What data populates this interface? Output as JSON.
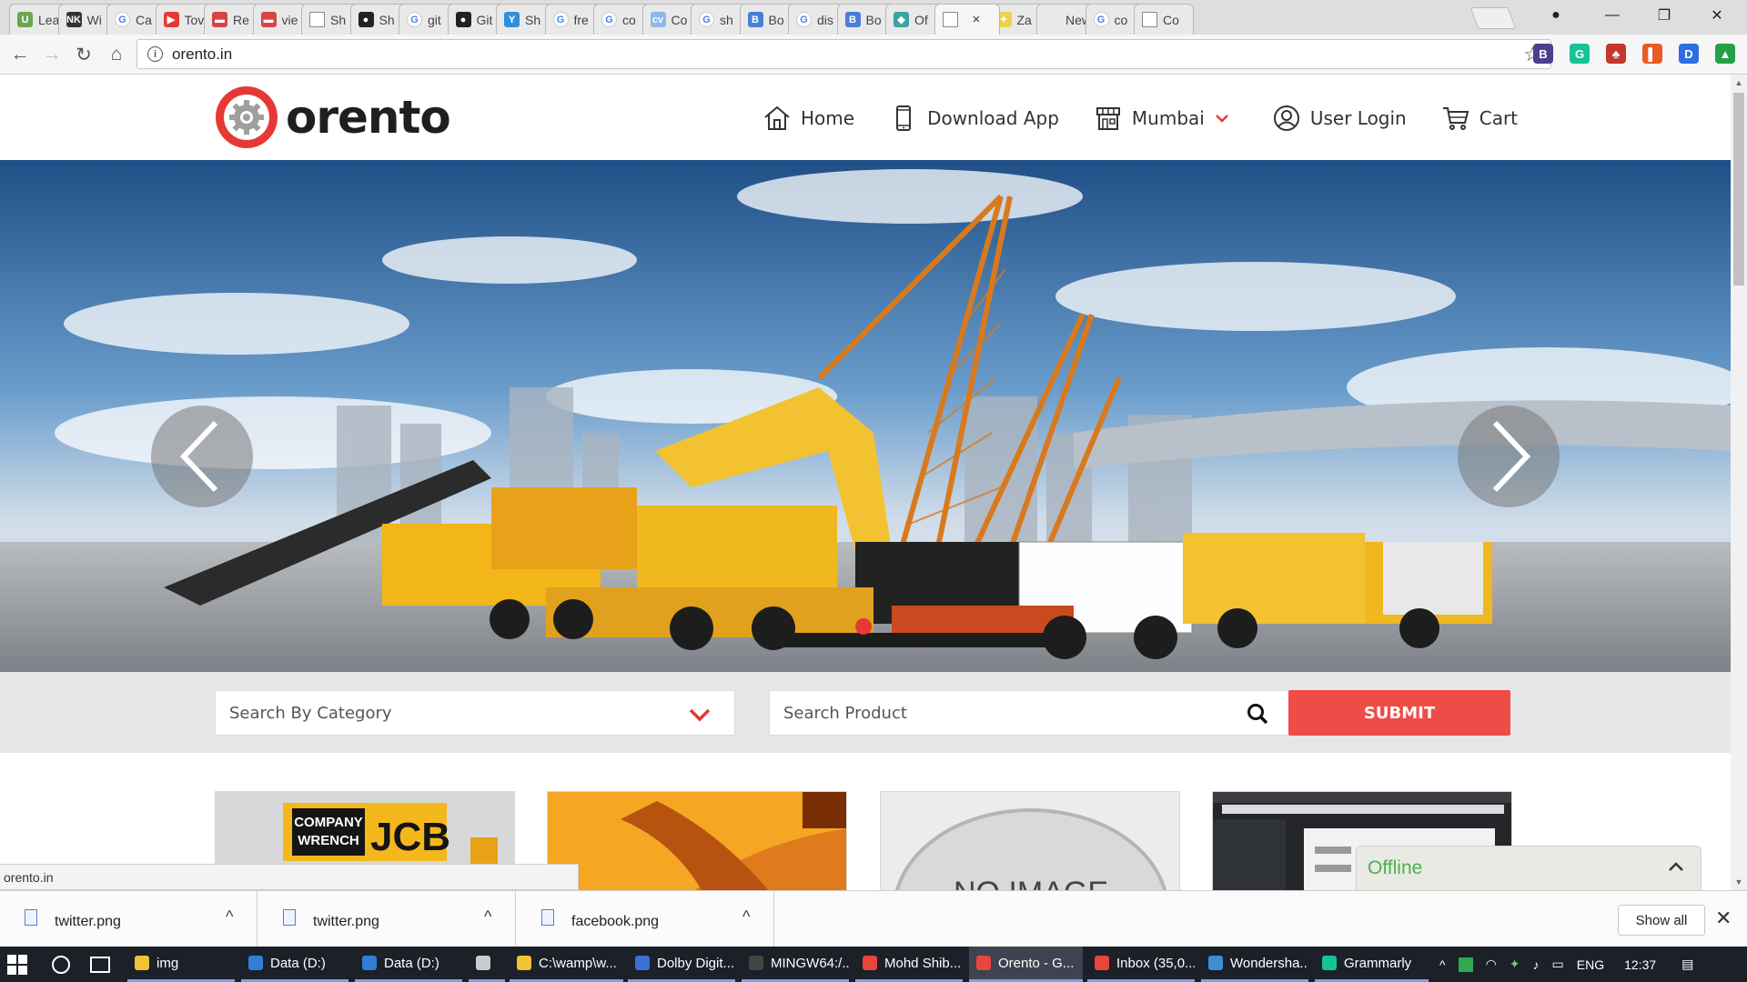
{
  "browser": {
    "tabs": [
      {
        "label": "Lea",
        "icon": "U",
        "color": "#6aa84f"
      },
      {
        "label": "Wi",
        "icon": "NK",
        "color": "#333333"
      },
      {
        "label": "Ca",
        "icon": "G",
        "color": "#ffffff",
        "google": true
      },
      {
        "label": "Tov",
        "icon": "▶",
        "color": "#e53935"
      },
      {
        "label": "Re",
        "icon": "▬",
        "color": "#d64545"
      },
      {
        "label": "vie",
        "icon": "▬",
        "color": "#d64545"
      },
      {
        "label": "Sh",
        "icon": "",
        "color": "#ffffff",
        "doc": true
      },
      {
        "label": "Sh",
        "icon": "●",
        "color": "#222222"
      },
      {
        "label": "git",
        "icon": "G",
        "color": "#ffffff",
        "google": true
      },
      {
        "label": "Git",
        "icon": "●",
        "color": "#222222"
      },
      {
        "label": "Sh",
        "icon": "Y",
        "color": "#2f8fd8"
      },
      {
        "label": "fre",
        "icon": "G",
        "color": "#ffffff",
        "google": true
      },
      {
        "label": "co",
        "icon": "G",
        "color": "#ffffff",
        "google": true
      },
      {
        "label": "Co",
        "icon": "cv",
        "color": "#8fb7e8"
      },
      {
        "label": "sh",
        "icon": "G",
        "color": "#ffffff",
        "google": true
      },
      {
        "label": "Bo",
        "icon": "B",
        "color": "#4a7fd4"
      },
      {
        "label": "dis",
        "icon": "G",
        "color": "#ffffff",
        "google": true
      },
      {
        "label": "Bo",
        "icon": "B",
        "color": "#4a7fd4"
      },
      {
        "label": "Of",
        "icon": "◆",
        "color": "#3aa3a3"
      },
      {
        "label": "",
        "icon": "",
        "color": "#ffffff",
        "doc": true,
        "active": true
      },
      {
        "label": "Za",
        "icon": "✦",
        "color": "#e8d34a"
      },
      {
        "label": "New Ta",
        "icon": "",
        "color": "#e9e9e9"
      },
      {
        "label": "co",
        "icon": "G",
        "color": "#ffffff",
        "google": true
      },
      {
        "label": "Co",
        "icon": "",
        "color": "#ffffff",
        "doc": true
      }
    ],
    "active_tab_close": "×",
    "window_controls": {
      "user": "●",
      "minimize": "—",
      "maximize": "❐",
      "close": "✕"
    },
    "nav": {
      "back": "←",
      "forward": "→",
      "reload": "↻",
      "home": "⌂"
    },
    "address": {
      "info": "i",
      "url": "orento.in",
      "bookmark": "☆"
    },
    "extensions": [
      {
        "label": "B",
        "color": "#4b3f8f"
      },
      {
        "label": "G",
        "color": "#15c39a"
      },
      {
        "label": "♣",
        "color": "#c0392b"
      },
      {
        "label": "▌",
        "color": "#eb5a24"
      },
      {
        "label": "D",
        "color": "#2c6fe0"
      },
      {
        "label": "▲",
        "color": "#24a148"
      }
    ]
  },
  "site": {
    "logo_text": "orento",
    "brand_color": "#e53935",
    "nav": {
      "home": "Home",
      "download": "Download App",
      "city": "Mumbai",
      "login": "User Login",
      "cart": "Cart"
    },
    "hero": {
      "prev": "‹",
      "next": "›"
    },
    "search": {
      "category_placeholder": "Search By Category",
      "product_placeholder": "Search Product",
      "submit": "SUBMIT"
    },
    "cards": [
      {
        "text_top": "COMPANY",
        "text_bottom": "WRENCH",
        "brand": "JCB"
      },
      {
        "text": ""
      },
      {
        "text": "NO IMAGE"
      },
      {
        "text": ""
      }
    ],
    "status_url": "orento.in",
    "chat": {
      "label": "Offline",
      "color": "#4caf50"
    }
  },
  "downloads": {
    "items": [
      "twitter.png",
      "twitter.png",
      "facebook.png"
    ],
    "caret": "^",
    "show_all": "Show all",
    "close": "✕"
  },
  "taskbar": {
    "apps": [
      {
        "label": "img",
        "color": "#f1c232"
      },
      {
        "label": "Data (D:)",
        "color": "#2f7fd8"
      },
      {
        "label": "Data (D:)",
        "color": "#2f7fd8"
      },
      {
        "label": "",
        "color": "#cccccc"
      },
      {
        "label": "C:\\wamp\\w...",
        "color": "#f1c232"
      },
      {
        "label": "Dolby Digit...",
        "color": "#3d6fd4"
      },
      {
        "label": "MINGW64:/...",
        "color": "#444444"
      },
      {
        "label": "Mohd Shib...",
        "color": "#e8453c"
      },
      {
        "label": "Orento - G...",
        "color": "#e8453c"
      },
      {
        "label": "Inbox (35,0...",
        "color": "#e8453c"
      },
      {
        "label": "Wondersha...",
        "color": "#3d8fd4"
      },
      {
        "label": "Grammarly",
        "color": "#15c39a"
      }
    ],
    "lang": "ENG",
    "time": "12:37"
  }
}
